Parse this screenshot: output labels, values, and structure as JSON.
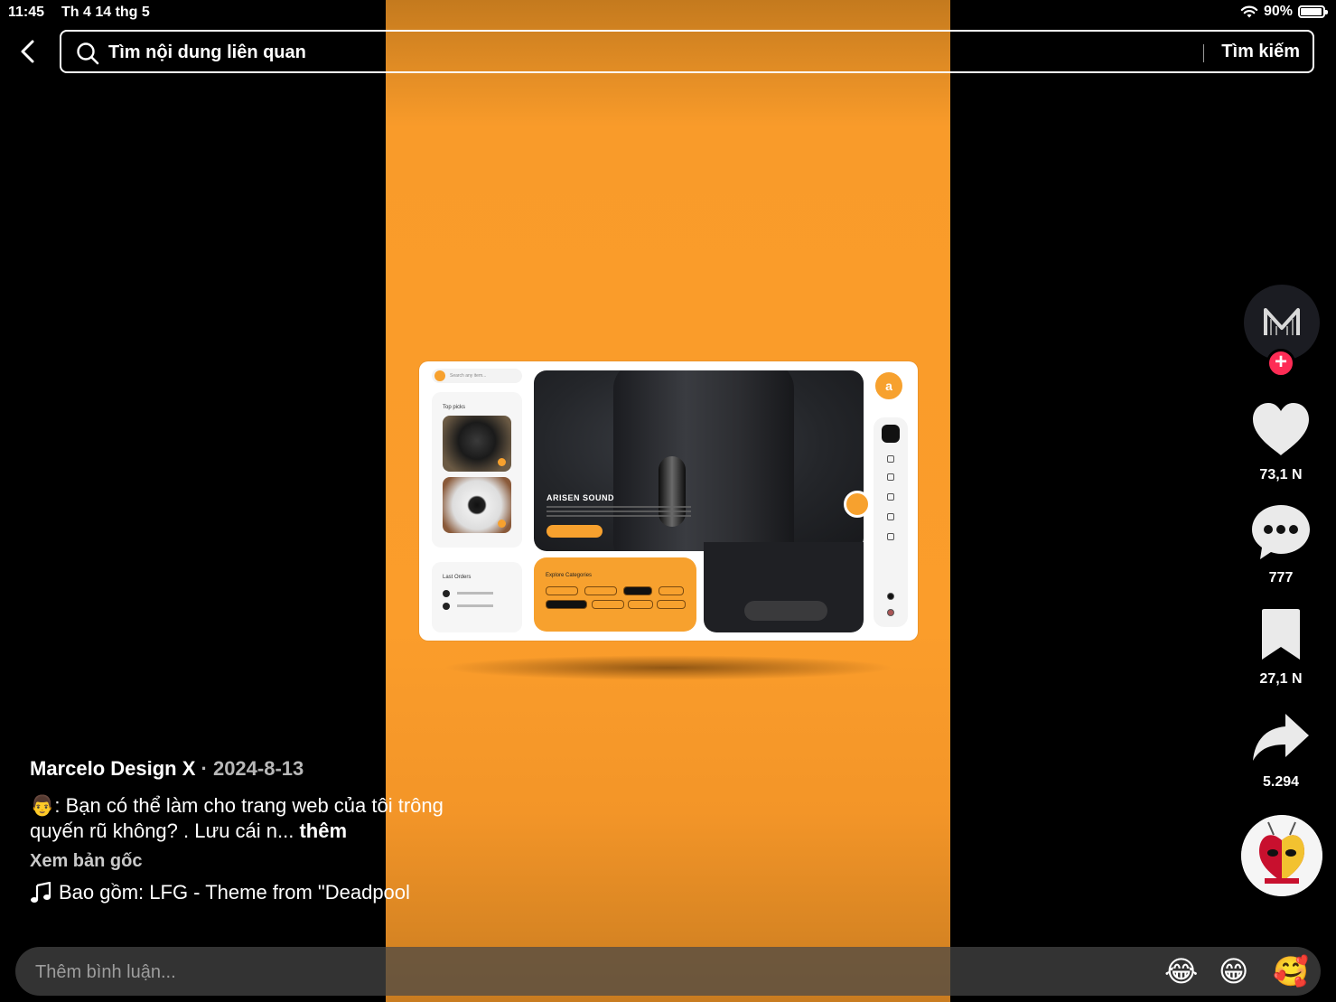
{
  "status_bar": {
    "time": "11:45",
    "date": "Th 4 14 thg 5",
    "battery": "90%"
  },
  "search": {
    "placeholder": "Tìm nội dung liên quan",
    "button": "Tìm kiếm"
  },
  "video": {
    "mockup": {
      "search_text": "Search any item...",
      "top_picks_label": "Top picks",
      "last_orders_label": "Last Orders",
      "categories_label": "Explore Categories",
      "hero_title": "ARISEN SOUND",
      "logo_letter": "a"
    },
    "colors": {
      "accent": "#f99b2a"
    }
  },
  "actions": {
    "likes": "73,1 N",
    "comments": "777",
    "saves": "27,1 N",
    "shares": "5.294"
  },
  "caption": {
    "author": "Marcelo Design X",
    "date": "· 2024-8-13",
    "emoji": "👨",
    "text": ": Bạn có thể làm cho trang web của tôi trông quyến rũ không? . Lưu cái n...",
    "more": "thêm",
    "original": "Xem bản gốc",
    "music": "Bao gồm: LFG - Theme from \"Deadpool"
  },
  "comment_bar": {
    "placeholder": "Thêm bình luận...",
    "emojis": [
      "😂",
      "😁",
      "🥰"
    ]
  },
  "icons": {
    "back": "chevron-left-icon",
    "search": "magnifier-icon",
    "like": "heart-icon",
    "comment": "ellipsis-bubble-icon",
    "save": "bookmark-icon",
    "share": "share-arrow-icon",
    "music": "music-note-icon"
  }
}
